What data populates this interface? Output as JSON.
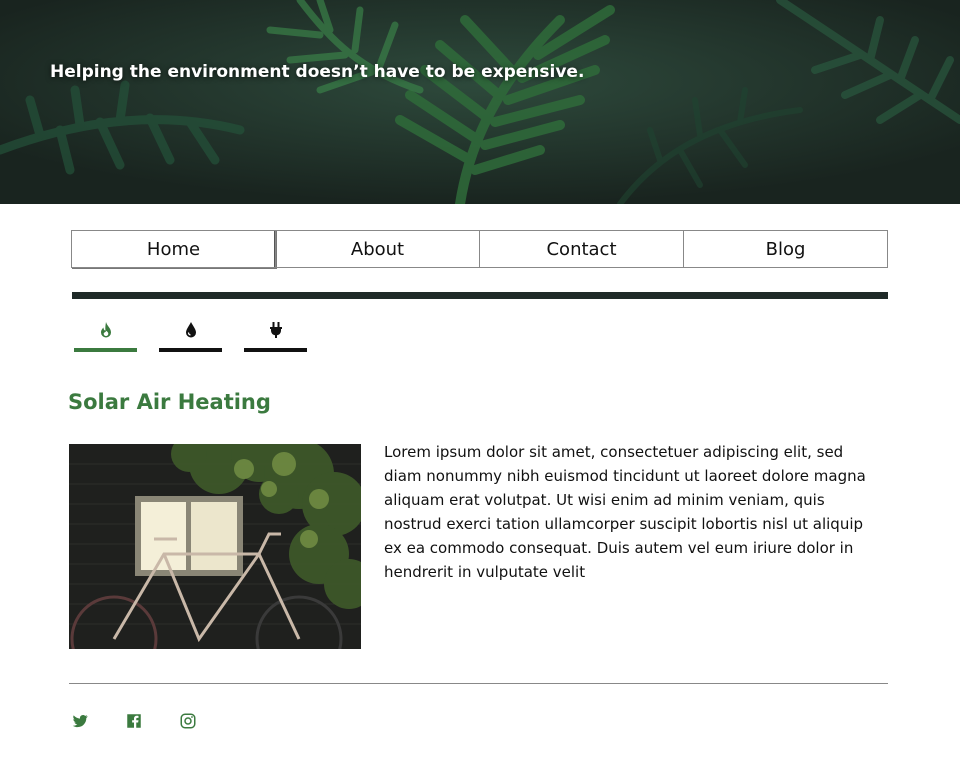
{
  "hero": {
    "tagline": "Helping the environment doesn’t have to be expensive."
  },
  "nav": {
    "items": [
      {
        "label": "Home",
        "active": true
      },
      {
        "label": "About"
      },
      {
        "label": "Contact"
      },
      {
        "label": "Blog"
      }
    ]
  },
  "tabs": [
    {
      "icon": "flame-icon",
      "active": true
    },
    {
      "icon": "water-drop-icon"
    },
    {
      "icon": "plug-icon"
    }
  ],
  "content": {
    "title": "Solar Air Heating",
    "image_icon": "bicycle-photo",
    "body": "Lorem ipsum dolor sit amet, consectetuer adipiscing elit, sed diam nonummy nibh euismod tincidunt ut laoreet dolore magna aliquam erat volutpat. Ut wisi enim ad minim veniam, quis nostrud exerci tation ullamcorper suscipit lobortis nisl ut aliquip ex ea commodo consequat. Duis autem vel eum iriure dolor in hendrerit in vulputate velit"
  },
  "footer": {
    "socials": [
      "twitter-icon",
      "facebook-icon",
      "instagram-icon"
    ]
  },
  "colors": {
    "accent": "#3b7a3f",
    "dark": "#1f2a28",
    "hero_bg": "#1d2a27"
  }
}
